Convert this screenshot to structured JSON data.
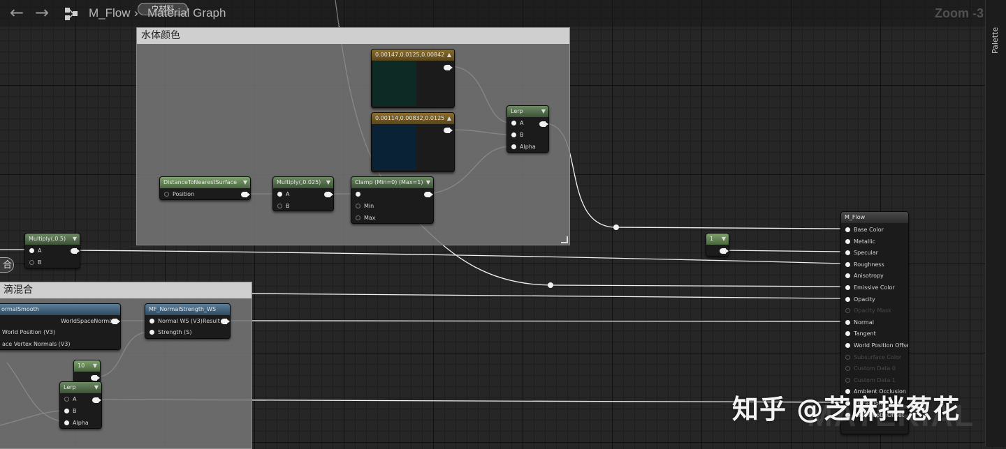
{
  "toolbar": {
    "back_icon": "arrow-left-icon",
    "forward_icon": "arrow-right-icon",
    "graph_icon": "material-graph-icon",
    "breadcrumb_asset": "M_Flow",
    "breadcrumb_separator": "›",
    "breadcrumb_graph": "Material Graph",
    "pill_label": "ウ材料",
    "zoom_label": "Zoom -3"
  },
  "side_panel": {
    "palette_label": "Palette"
  },
  "comments": {
    "water_color": "水体颜色",
    "normal_blend": "滴混合"
  },
  "nodes": {
    "color1": {
      "title": "0.00147,0.0125,0.00842",
      "swatch": "#0d2a24"
    },
    "color2": {
      "title": "0.00114,0.00832,0.0125",
      "swatch": "#0a2236"
    },
    "lerp_top": {
      "title": "Lerp",
      "a": "A",
      "b": "B",
      "alpha": "Alpha"
    },
    "distance": {
      "title": "DistanceToNearestSurface",
      "position": "Position"
    },
    "multiply_025": {
      "title": "Multiply(,0.025)",
      "a": "A",
      "b": "B"
    },
    "clamp": {
      "title": "Clamp (Min=0) (Max=1)",
      "min": "Min",
      "max": "Max"
    },
    "multiply_05": {
      "title": "Multiply(,0.5)",
      "a": "A",
      "b": "B"
    },
    "const_1": {
      "title": "1"
    },
    "normal_smooth": {
      "title": "ormalSmooth",
      "out": "WorldSpaceNormal",
      "in1": "World Position (V3)",
      "in2": "ace Vertex Normals (V3)"
    },
    "mf_normal": {
      "title": "MF_NormalStrength_WS",
      "in1": "Normal WS (V3)",
      "in2": "Strength (S)",
      "out": "Result"
    },
    "const_10": {
      "title": "10"
    },
    "lerp_bottom": {
      "title": "Lerp",
      "a": "A",
      "b": "B",
      "alpha": "Alpha"
    },
    "m_flow": {
      "title": "M_Flow",
      "pins": [
        "Base Color",
        "Metallic",
        "Specular",
        "Roughness",
        "Anisotropy",
        "Emissive Color",
        "Opacity",
        "Opacity Mask",
        "Normal",
        "Tangent",
        "World Position Offset",
        "Subsurface Color",
        "Custom Data 0",
        "Custom Data 1",
        "Ambient Occlusion",
        "Refraction",
        "Pixel Depth Offset"
      ],
      "dimmed": [
        7,
        11,
        12,
        13
      ]
    }
  },
  "misc": {
    "side_button_label": "合"
  },
  "watermark": {
    "author": "知乎 @芝麻拌葱花",
    "logo_text": "MATERIAL"
  },
  "colors": {
    "background": "#262626",
    "wire": "#f2f2f2",
    "comment_header": "#cfcfcf"
  }
}
